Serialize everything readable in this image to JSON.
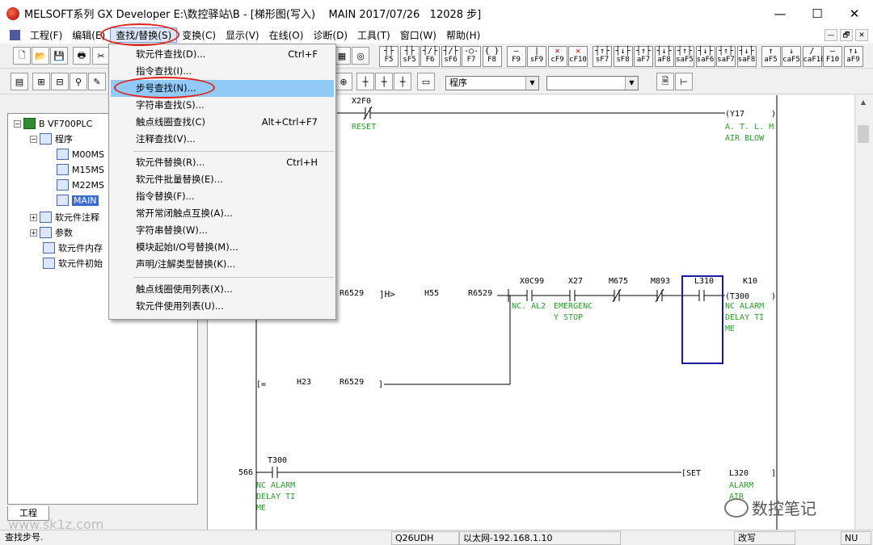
{
  "window": {
    "title": "MELSOFT系列 GX Developer E:\\数控驿站\\B - [梯形图(写入)    MAIN 2017/07/26   12028 步]",
    "minimize": "—",
    "maximize": "☐",
    "close": "✕"
  },
  "menubar": {
    "items": [
      "工程(F)",
      "编辑(E)",
      "查找/替换(S)",
      "变换(C)",
      "显示(V)",
      "在线(O)",
      "诊断(D)",
      "工具(T)",
      "窗口(W)",
      "帮助(H)"
    ],
    "mdi": [
      "—",
      "🗗",
      "✕"
    ]
  },
  "toolbar": {
    "fkeys": [
      {
        "sym": "┤├",
        "label": "F5"
      },
      {
        "sym": "┤├",
        "label": "sF5"
      },
      {
        "sym": "┤/├",
        "label": "F6"
      },
      {
        "sym": "┤/├",
        "label": "sF6"
      },
      {
        "sym": "-○-",
        "label": "F7"
      },
      {
        "sym": "{ }",
        "label": "F8"
      },
      {
        "sym": "—",
        "label": "F9"
      },
      {
        "sym": "|",
        "label": "sF9"
      },
      {
        "sym": "✕",
        "label": "cF9"
      },
      {
        "sym": "✕",
        "label": "cF10"
      },
      {
        "sym": "┤↑├",
        "label": "sF7"
      },
      {
        "sym": "┤↓├",
        "label": "sF8"
      },
      {
        "sym": "┤↑├",
        "label": "aF7"
      },
      {
        "sym": "┤↓├",
        "label": "aF8"
      },
      {
        "sym": "┤↑├",
        "label": "saF5"
      },
      {
        "sym": "┤↓├",
        "label": "saF6"
      },
      {
        "sym": "┤↑├",
        "label": "saF7"
      },
      {
        "sym": "┤↓├",
        "label": "saF8"
      },
      {
        "sym": "↑",
        "label": "aF5"
      },
      {
        "sym": "↓",
        "label": "caF5"
      },
      {
        "sym": "/",
        "label": "caF10"
      },
      {
        "sym": "—",
        "label": "F10"
      },
      {
        "sym": "↑↓",
        "label": "aF9"
      }
    ],
    "combo_program": "程序",
    "combo_blank": ""
  },
  "tree": {
    "root": "B VF700PLC",
    "program": "程序",
    "programs": [
      "M00MS",
      "M15MS",
      "M22MS",
      "MAIN"
    ],
    "device_comment": "软元件注释",
    "params": "参数",
    "device_memory": "软元件内存",
    "device_init": "软元件初始",
    "tab": "工程"
  },
  "dropdown": {
    "items": [
      {
        "label": "软元件查找(D)...",
        "shortcut": "Ctrl+F"
      },
      {
        "label": "指令查找(I)...",
        "shortcut": ""
      },
      {
        "label": "步号查找(N)...",
        "shortcut": ""
      },
      {
        "label": "字符串查找(S)...",
        "shortcut": ""
      },
      {
        "label": "触点线圈查找(C)",
        "shortcut": "Alt+Ctrl+F7"
      },
      {
        "label": "注释查找(V)...",
        "shortcut": ""
      },
      {
        "label": "软元件替换(R)...",
        "shortcut": "Ctrl+H"
      },
      {
        "label": "软元件批量替换(E)...",
        "shortcut": ""
      },
      {
        "label": "指令替换(F)...",
        "shortcut": ""
      },
      {
        "label": "常开常闭触点互换(A)...",
        "shortcut": ""
      },
      {
        "label": "字符串替换(W)...",
        "shortcut": ""
      },
      {
        "label": "模块起始I/O号替换(M)...",
        "shortcut": ""
      },
      {
        "label": "声明/注解类型替换(K)...",
        "shortcut": ""
      },
      {
        "label": "触点线圈使用列表(X)...",
        "shortcut": ""
      },
      {
        "label": "软元件使用列表(U)...",
        "shortcut": ""
      }
    ]
  },
  "ladder": {
    "x2f0": "X2F0",
    "reset": "RESET",
    "y17": "Y17",
    "y17_comment1": "A. T. L. M",
    "y17_comment2": "AIR BLOW",
    "r6529_a": "R6529",
    "cmp_op": "]H>",
    "h55": "H55",
    "r6529_b": "R6529",
    "x0c99": "X0C99",
    "x0c99_comment": "NC. AL2",
    "x27": "X27",
    "x27_comment1": "EMERGENC",
    "x27_comment2": "Y STOP",
    "m675": "M675",
    "m893": "M893",
    "l310": "L310",
    "t300_coil": "T300",
    "k10": "K10",
    "t300_c1": "NC ALARM",
    "t300_c2": "DELAY TI",
    "t300_c3": "ME",
    "eq_op": "[=",
    "h23": "H23",
    "r6529_c": "R6529",
    "step_566": "566",
    "t300_contact": "T300",
    "t300b_c1": "NC ALARM",
    "t300b_c2": "DELAY TI",
    "t300b_c3": "ME",
    "set_op": "[SET",
    "l320": "L320",
    "l320_c1": "ALARM",
    "l320_c2": "AIR"
  },
  "statusbar": {
    "message": "查找步号.",
    "cpu": "Q26UDH",
    "connection": "以太网-192.168.1.10",
    "mode": "改写",
    "num": "NU"
  },
  "watermark": "www.sk1z.com",
  "brand": "数控笔记"
}
